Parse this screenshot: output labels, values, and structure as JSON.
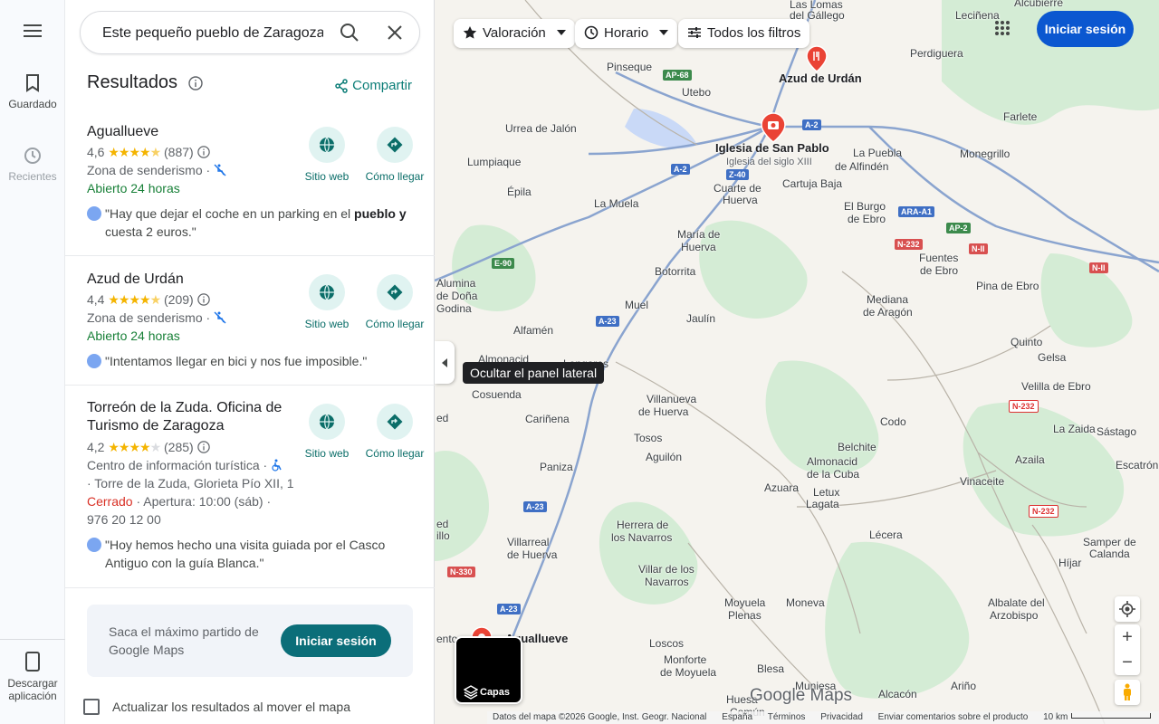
{
  "rail": {
    "saved": "Guardado",
    "recent": "Recientes",
    "download": "Descargar aplicación"
  },
  "search": {
    "query": "Este pequeño pueblo de Zaragoza e"
  },
  "results": {
    "title": "Resultados",
    "share": "Compartir",
    "website": "Sitio web",
    "directions": "Cómo llegar",
    "items": [
      {
        "name": "Agualluеve",
        "rating": "4,6",
        "stars": "★★★★",
        "half": "★",
        "reviews": "(887)",
        "category": "Zona de senderismo ·",
        "hours": "Abierto 24 horas",
        "review_pre": "\"Hay que dejar el coche en un parking en el ",
        "review_bold1": "pueblo",
        "review_mid": " ",
        "review_bold2": "y",
        "review_post": " cuesta 2 euros.\""
      },
      {
        "name": "Azud de Urdán",
        "rating": "4,4",
        "stars": "★★★★",
        "half": "★",
        "reviews": "(209)",
        "category": "Zona de senderismo ·",
        "hours": "Abierto 24 horas",
        "review": "\"Intentamos llegar en bici y nos fue imposible.\""
      },
      {
        "name": "Torreón de la Zuda. Oficina de Turismo de Zaragoza",
        "rating": "4,2",
        "stars": "★★★★",
        "off": "★",
        "reviews": "(285)",
        "category": "Centro de información turística ·",
        "address": "· Torre de la Zuda, Glorieta Pío XII, 1",
        "status": "Cerrado",
        "opening": " · Apertura: 10:00 (sáb) ·",
        "phone": "976 20 12 00",
        "review": "\"Hoy hemos hecho una visita guiada por el Casco Antiguo con la guía Blanca.\""
      }
    ]
  },
  "promo": {
    "text": "Saca el máximo partido de Google Maps",
    "button": "Iniciar sesión"
  },
  "update_checkbox": "Actualizar los resultados al mover el mapa",
  "map": {
    "chips": {
      "rating": "Valoración",
      "hours": "Horario",
      "filters": "Todos los filtros"
    },
    "signin": "Iniciar sesión",
    "tooltip": "Ocultar el panel lateral",
    "layers": "Capas",
    "logo": "Google Maps",
    "places": {
      "acubierre": "Alcubierre",
      "lasLomas": "Las Lomas",
      "delGallego": "del Gállego",
      "leciñena": "Leciñena",
      "perdiguera": "Perdiguera",
      "pinseque": "Pinseque",
      "azudUrdan": "Azud de Urdán",
      "utebo": "Utebo",
      "farlete": "Farlete",
      "urrea": "Urrea de Jalón",
      "iglesia": "Iglesia de San Pablo",
      "iglesiaSub": "Iglesia del siglo XIII",
      "puebla1": "La Puebla",
      "puebla2": "de Alfindén",
      "monegrillo": "Monegrillo",
      "lumpiaque": "Lumpiaque",
      "cuarte1": "Cuarte de",
      "cuarte2": "Huerva",
      "cartuja": "Cartuja Baja",
      "epila": "Épila",
      "lamuela": "La Muela",
      "burgo1": "El Burgo",
      "burgo2": "de Ebro",
      "maria1": "María de",
      "maria2": "Huerva",
      "botorrita": "Botorrita",
      "fuentes1": "Fuentes",
      "fuentes2": "de Ebro",
      "pina": "Pina de Ebro",
      "alumina1": "Alumina",
      "alumina2": "de Doña",
      "alumina3": "Godina",
      "muel": "Muel",
      "mediana1": "Mediana",
      "mediana2": "de Aragón",
      "alfamen": "Alfamén",
      "jaulin": "Jaulín",
      "quinto": "Quinto",
      "gelsa": "Gelsa",
      "almonacid": "Almonacid",
      "longares": "Longares",
      "velilla": "Velilla de Ebro",
      "cosuenda": "Cosuenda",
      "carinena": "Cariñena",
      "villanueva1": "Villanueva",
      "villanueva2": "de Huerva",
      "codo": "Codo",
      "laZaida": "La Zaida",
      "sastago": "Sástago",
      "tosos": "Tosos",
      "belchite": "Belchite",
      "aguilon": "Aguilón",
      "almonacidCuba1": "Almonacid",
      "almonacidCuba2": "de la Cuba",
      "azaila": "Azaila",
      "escatron": "Escatrón",
      "paniza": "Paniza",
      "azuara": "Azuara",
      "letux": "Letux",
      "lagata": "Lagata",
      "vinaceite": "Vinaceite",
      "herrera1": "Herrera de",
      "herrera2": "los Navarros",
      "lecera": "Lécera",
      "samper1": "Samper de",
      "samper2": "Calanda",
      "villarreal1": "Villarreal",
      "villarreal2": "de Huerva",
      "hijar": "Híjar",
      "villarLosNav1": "Villar de los",
      "villarLosNav2": "Navarros",
      "moyuela": "Moyuela",
      "moneva": "Moneva",
      "albalate1": "Albalate del",
      "albalate2": "Arzobispo",
      "plenas": "Plenas",
      "agualleve": "Aguallueve",
      "loscos": "Loscos",
      "monforte1": "Monforte",
      "monforte2": "de Moyuela",
      "blesa": "Blesa",
      "muniesa": "Muniesa",
      "arino": "Ariño",
      "alcacon": "Alcacón",
      "huesa": "Huesa",
      "comun": "Común",
      "ed": "ed",
      "illo": "illo",
      "ento": "ento"
    },
    "roads": {
      "ap68": "AP-68",
      "a2a": "A-2",
      "a2b": "A-2",
      "z40": "Z-40",
      "araA1": "ARA-A1",
      "ap2": "AP-2",
      "n232a": "N-232",
      "n2a": "N-II",
      "n2b": "N-II",
      "e90": "E-90",
      "a23a": "A-23",
      "a23b": "A-23",
      "a23c": "A-23",
      "n232b": "N-232",
      "n232c": "N-232",
      "n330": "N-330"
    },
    "footer": {
      "data": "Datos del mapa ©2026 Google, Inst. Geogr. Nacional",
      "country": "España",
      "terms": "Términos",
      "privacy": "Privacidad",
      "feedback": "Enviar comentarios sobre el producto",
      "scale": "10 km"
    },
    "colors": {
      "land": "#f5f3ee",
      "green": "#d4ecd5",
      "water": "#c9d9f7",
      "road": "#8aa4cf",
      "accent": "#0b57d0"
    }
  }
}
